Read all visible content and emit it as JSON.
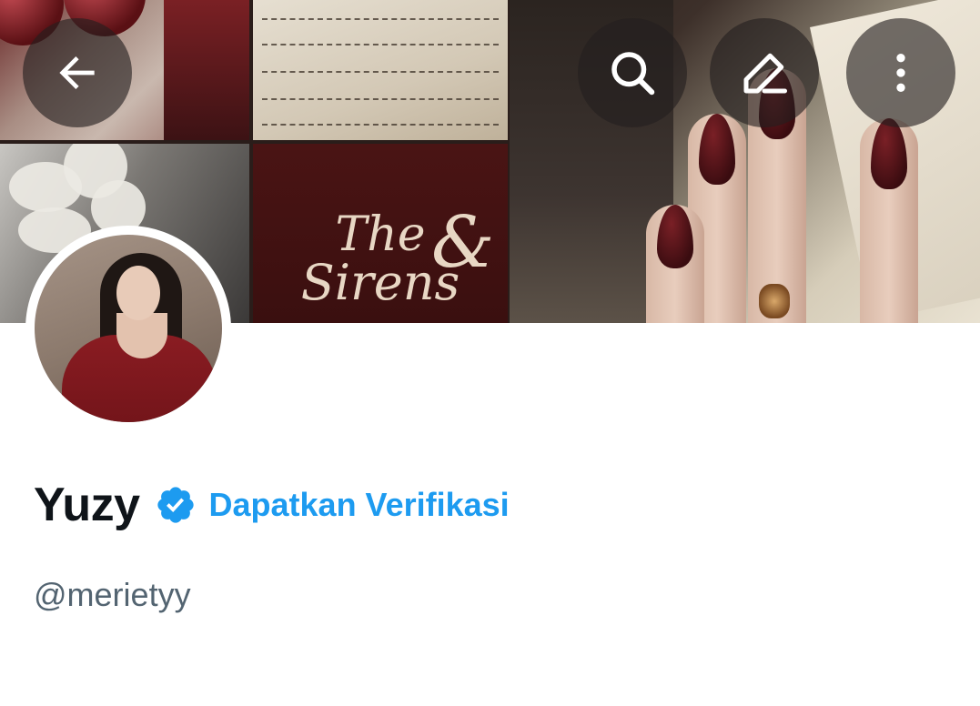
{
  "header": {
    "back_icon": "arrow-left-icon",
    "search_icon": "search-icon",
    "edit_icon": "pencil-icon",
    "more_icon": "more-vertical-icon"
  },
  "banner": {
    "sirens_line1": "The",
    "sirens_line2": "Sirens",
    "sirens_ampersand": "&"
  },
  "profile": {
    "display_name": "Yuzy",
    "verified_icon": "verified-badge-icon",
    "get_verified_label": "Dapatkan Verifikasi",
    "handle": "@merietyy"
  },
  "colors": {
    "accent": "#1d9bf0",
    "name_text": "#0f1419",
    "secondary_text": "#536471",
    "icon_button_bg": "rgba(35,30,30,0.62)"
  }
}
